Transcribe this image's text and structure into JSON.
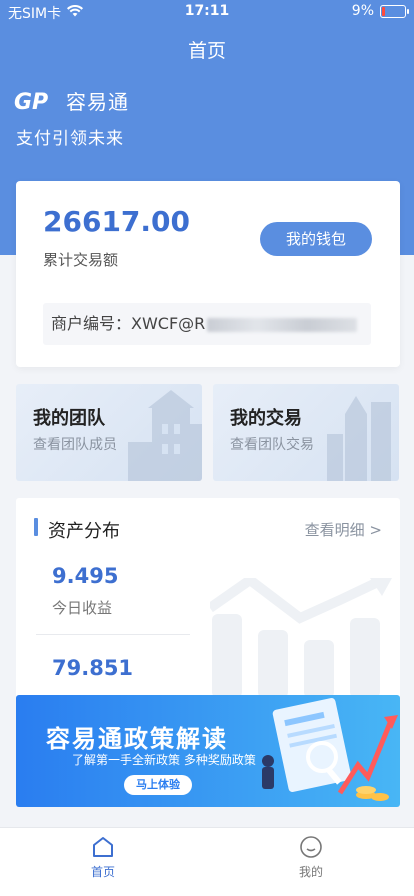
{
  "status_bar": {
    "carrier": "无SIM卡",
    "time": "17:11",
    "battery": "9%"
  },
  "nav": {
    "title": "首页"
  },
  "brand": {
    "logo_text": "GP",
    "name": "容易通",
    "slogan": "支付引领未来"
  },
  "wallet": {
    "amount": "26617.00",
    "amount_label": "累计交易额",
    "button_label": "我的钱包",
    "merchant_label": "商户编号：",
    "merchant_prefix": "XWCF@R"
  },
  "tiles": {
    "team": {
      "title": "我的团队",
      "subtitle": "查看团队成员"
    },
    "trade": {
      "title": "我的交易",
      "subtitle": "查看团队交易"
    }
  },
  "asset": {
    "title": "资产分布",
    "more": "查看明细 >",
    "today_value": "9.495",
    "today_label": "今日收益",
    "second_value": "79.851"
  },
  "banner": {
    "title": "容易通政策解读",
    "subtitle": "了解第一手全新政策 多种奖励政策",
    "button": "马上体验"
  },
  "tabbar": {
    "home": "首页",
    "me": "我的"
  },
  "colors": {
    "accent": "#5a8ee0",
    "value": "#3d6fd0"
  }
}
